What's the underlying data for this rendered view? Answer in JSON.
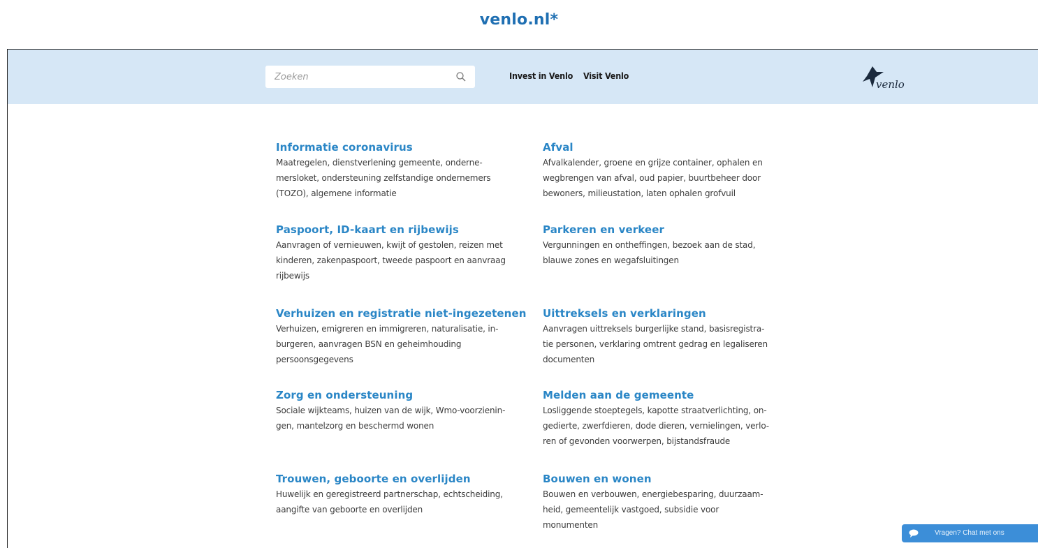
{
  "caption": "venlo.nl*",
  "header": {
    "search_placeholder": "Zoeken",
    "links": [
      "Invest in Venlo",
      "Visit Venlo"
    ],
    "logo_text": "venlo"
  },
  "topics": [
    {
      "title": "Informatie coronavirus",
      "lines": [
        "Maatregelen, dienstverlening gemeente, onderne-",
        "mersloket, ondersteuning zelfstandige ondernemers",
        "(TOZO), algemene informatie"
      ]
    },
    {
      "title": "Afval",
      "lines": [
        "Afvalkalender, groene en grijze container, ophalen en",
        "wegbrengen van afval, oud papier, buurtbeheer door",
        "bewoners, milieustation, laten ophalen grofvuil"
      ]
    },
    {
      "title": "Paspoort, ID-kaart en rijbewijs",
      "lines": [
        "Aanvragen of vernieuwen, kwijt of gestolen, reizen met",
        "kinderen, zakenpaspoort, tweede paspoort en aanvraag",
        "rijbewijs"
      ]
    },
    {
      "title": "Parkeren en verkeer",
      "lines": [
        "Vergunningen en ontheffingen, bezoek aan de stad,",
        "blauwe zones en wegafsluitingen"
      ]
    },
    {
      "title": "Verhuizen en registratie niet-ingezetenen",
      "lines": [
        "Verhuizen, emigreren en immigreren, naturalisatie, in-",
        "burgeren, aanvragen BSN en geheimhouding",
        "persoonsgegevens"
      ]
    },
    {
      "title": "Uittreksels en verklaringen",
      "lines": [
        "Aanvragen uittreksels burgerlijke stand, basisregistra-",
        "tie personen, verklaring omtrent gedrag en legaliseren",
        "documenten"
      ]
    },
    {
      "title": "Zorg en ondersteuning",
      "lines": [
        "Sociale wijkteams, huizen van de wijk, Wmo-voorzienin-",
        "gen, mantelzorg en beschermd wonen"
      ]
    },
    {
      "title": "Melden aan de gemeente",
      "lines": [
        "Losliggende stoeptegels, kapotte straatverlichting, on-",
        "gedierte, zwerfdieren, dode dieren, vernielingen, verlo-",
        "ren of gevonden voorwerpen, bijstandsfraude"
      ]
    },
    {
      "title": "Trouwen, geboorte en overlijden",
      "lines": [
        "Huwelijk en geregistreerd partnerschap, echtscheiding,",
        "aangifte van geboorte en overlijden"
      ]
    },
    {
      "title": "Bouwen en wonen",
      "lines": [
        "Bouwen en verbouwen, energiebesparing, duurzaam-",
        "heid, gemeentelijk vastgoed, subsidie voor",
        "monumenten"
      ]
    }
  ],
  "chat_label": "Vragen? Chat met ons",
  "colors": {
    "accent": "#2a86c6",
    "header_bg": "#d6e7f6",
    "caption": "#1f6fb2",
    "chat_bg": "#3c8ed8"
  }
}
